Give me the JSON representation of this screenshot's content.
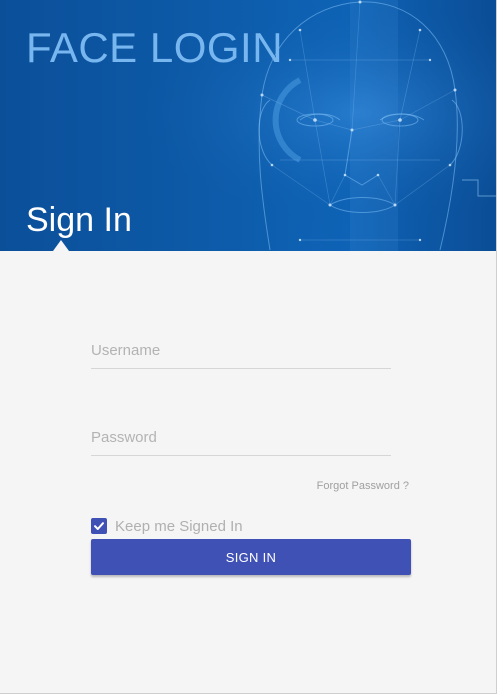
{
  "header": {
    "brand_title": "FACE LOGIN",
    "section_title": "Sign In",
    "background_color": "#0d5aa8",
    "illustration": "face-wireframe-illustration"
  },
  "form": {
    "username": {
      "placeholder": "Username",
      "value": ""
    },
    "password": {
      "placeholder": "Password",
      "value": ""
    },
    "forgot_password_label": "Forgot Password ?",
    "remember_label": "Keep me Signed In",
    "remember_checked": true,
    "submit_label": "SIGN IN",
    "accent_color": "#3f51b5"
  },
  "icons": {
    "checkbox": "check-icon"
  }
}
